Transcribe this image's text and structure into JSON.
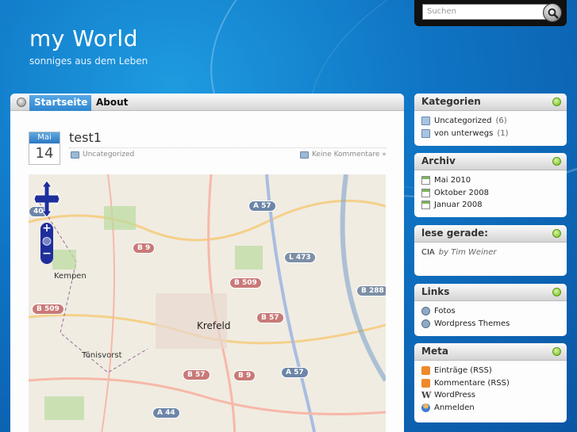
{
  "site": {
    "title": "my World",
    "tagline": "sonniges aus dem Leben"
  },
  "search": {
    "placeholder": "Suchen"
  },
  "nav": {
    "tabs": [
      "Startseite",
      "About"
    ]
  },
  "post": {
    "month": "Mai",
    "day": "14",
    "title": "test1",
    "category": "Uncategorized",
    "comments": "Keine Kommentare »"
  },
  "map": {
    "cities": [
      "Kempen",
      "Krefeld",
      "Tönisvorst"
    ],
    "shields": [
      "A 57",
      "B 9",
      "B 509",
      "L 473",
      "B 288",
      "B 509",
      "B 57",
      "B 57",
      "B 9",
      "A 57",
      "A 44",
      "40"
    ]
  },
  "sidebar": {
    "categories": {
      "title": "Kategorien",
      "items": [
        {
          "label": "Uncategorized",
          "count": "(6)"
        },
        {
          "label": "von unterwegs",
          "count": "(1)"
        }
      ]
    },
    "archive": {
      "title": "Archiv",
      "items": [
        "Mai 2010",
        "Oktober 2008",
        "Januar 2008"
      ]
    },
    "reading": {
      "title": "lese gerade:",
      "book": "CIA",
      "by": "by Tim Weiner"
    },
    "links": {
      "title": "Links",
      "items": [
        "Fotos",
        "Wordpress Themes"
      ]
    },
    "meta": {
      "title": "Meta",
      "items": [
        "Einträge (RSS)",
        "Kommentare (RSS)",
        "WordPress",
        "Anmelden"
      ]
    }
  }
}
